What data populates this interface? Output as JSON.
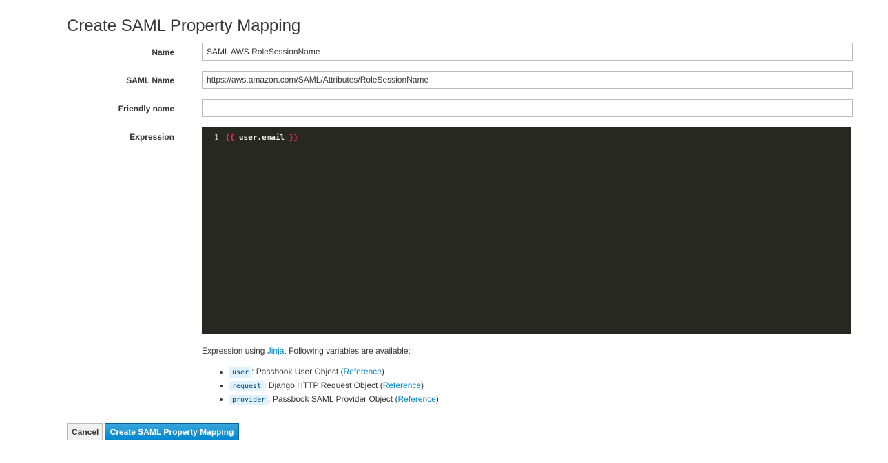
{
  "page": {
    "title": "Create SAML Property Mapping"
  },
  "form": {
    "name": {
      "label": "Name",
      "value": "SAML AWS RoleSessionName"
    },
    "saml_name": {
      "label": "SAML Name",
      "value": "https://aws.amazon.com/SAML/Attributes/RoleSessionName"
    },
    "friendly_name": {
      "label": "Friendly name",
      "value": ""
    },
    "expression": {
      "label": "Expression",
      "line_number": "1",
      "open": "{{",
      "body": " user.email ",
      "close": "}}"
    }
  },
  "help": {
    "prefix": "Expression using ",
    "link": "Jinja",
    "suffix": ". Following variables are available:",
    "variables": [
      {
        "name": "user",
        "desc": ": Passbook User Object (",
        "link": "Reference",
        "end": ")"
      },
      {
        "name": "request",
        "desc": ": Django HTTP Request Object (",
        "link": "Reference",
        "end": ")"
      },
      {
        "name": "provider",
        "desc": ": Passbook SAML Provider Object (",
        "link": "Reference",
        "end": ")"
      }
    ]
  },
  "buttons": {
    "cancel": "Cancel",
    "submit": "Create SAML Property Mapping"
  },
  "colors": {
    "primary": "#0088ce",
    "editor_bg": "#272822",
    "brace": "#f92672"
  }
}
